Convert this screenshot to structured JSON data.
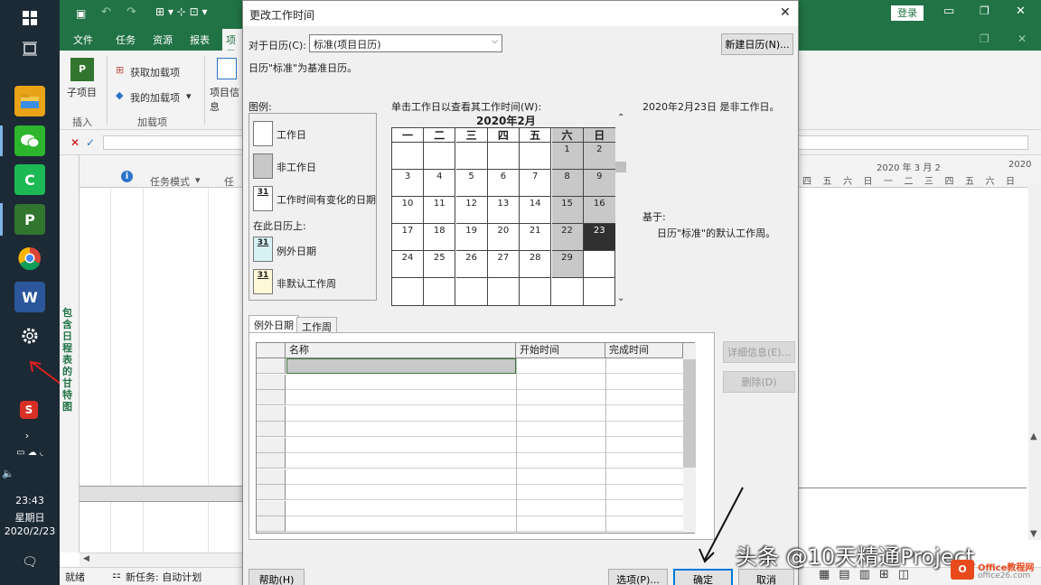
{
  "taskbar": {
    "clock_time": "23:43",
    "clock_day": "星期日",
    "clock_date": "2020/2/23"
  },
  "project": {
    "login": "登录",
    "tabs": [
      "文件",
      "任务",
      "资源",
      "报表",
      "项目"
    ],
    "ribbon": {
      "subproject": "子项目",
      "get_addins": "获取加载项",
      "my_addins": "我的加载项",
      "project_info": "项目信息",
      "group_insert": "插入",
      "group_addins": "加载项"
    },
    "columns": {
      "info_icon": "i",
      "task_mode": "任务模式",
      "task_name": "任务"
    },
    "gantt_side_label": "包含日程表的甘特图",
    "timeline_week": "2020 年 3 月 2",
    "timeline_week2": "2020",
    "day_headers": [
      "四",
      "五",
      "六",
      "日",
      "一",
      "二",
      "三",
      "四",
      "五",
      "六",
      "日"
    ],
    "status": {
      "ready": "就绪",
      "new_task": "新任务: 自动计划"
    }
  },
  "dialog": {
    "title": "更改工作时间",
    "for_calendar_label": "对于日历(C):",
    "calendar_value": "标准(项目日历)",
    "new_calendar_btn": "新建日历(N)...",
    "base_calendar_note": "日历\"标准\"为基准日历。",
    "legend_title": "图例:",
    "legend": {
      "working": "工作日",
      "nonworking": "非工作日",
      "edited": "工作时间有变化的日期",
      "on_this_calendar": "在此日历上:",
      "exception_day": "例外日期",
      "nondefault_week": "非默认工作周",
      "swatch_number": "31"
    },
    "click_hint": "单击工作日以查看其工作时间(W):",
    "calendar_month": "2020年2月",
    "weekday_headers": [
      "一",
      "二",
      "三",
      "四",
      "五",
      "六",
      "日"
    ],
    "weeks": [
      [
        "",
        "",
        "",
        "",
        "",
        "1",
        "2"
      ],
      [
        "3",
        "4",
        "5",
        "6",
        "7",
        "8",
        "9"
      ],
      [
        "10",
        "11",
        "12",
        "13",
        "14",
        "15",
        "16"
      ],
      [
        "17",
        "18",
        "19",
        "20",
        "21",
        "22",
        "23"
      ],
      [
        "24",
        "25",
        "26",
        "27",
        "28",
        "29",
        ""
      ],
      [
        "",
        "",
        "",
        "",
        "",
        "",
        ""
      ]
    ],
    "selected_info": "2020年2月23日 是非工作日。",
    "based_on_label": "基于:",
    "based_on_value": "日历\"标准\"的默认工作周。",
    "tab_exceptions": "例外日期",
    "tab_workweek": "工作周",
    "grid_headers": [
      "名称",
      "开始时间",
      "完成时间"
    ],
    "details_btn": "详细信息(E)...",
    "delete_btn": "删除(D)",
    "help_btn": "帮助(H)",
    "options_btn": "选项(P)...",
    "ok_btn": "确定",
    "cancel_btn": "取消",
    "close_glyph": "✕"
  },
  "watermark": {
    "text": "头条 @10天精通Project",
    "site": "office26.com",
    "brand": "Office教程网"
  },
  "colors": {
    "project_green": "#217346",
    "taskbar": "#1c2a36",
    "accent_arrow": "#e02020"
  }
}
